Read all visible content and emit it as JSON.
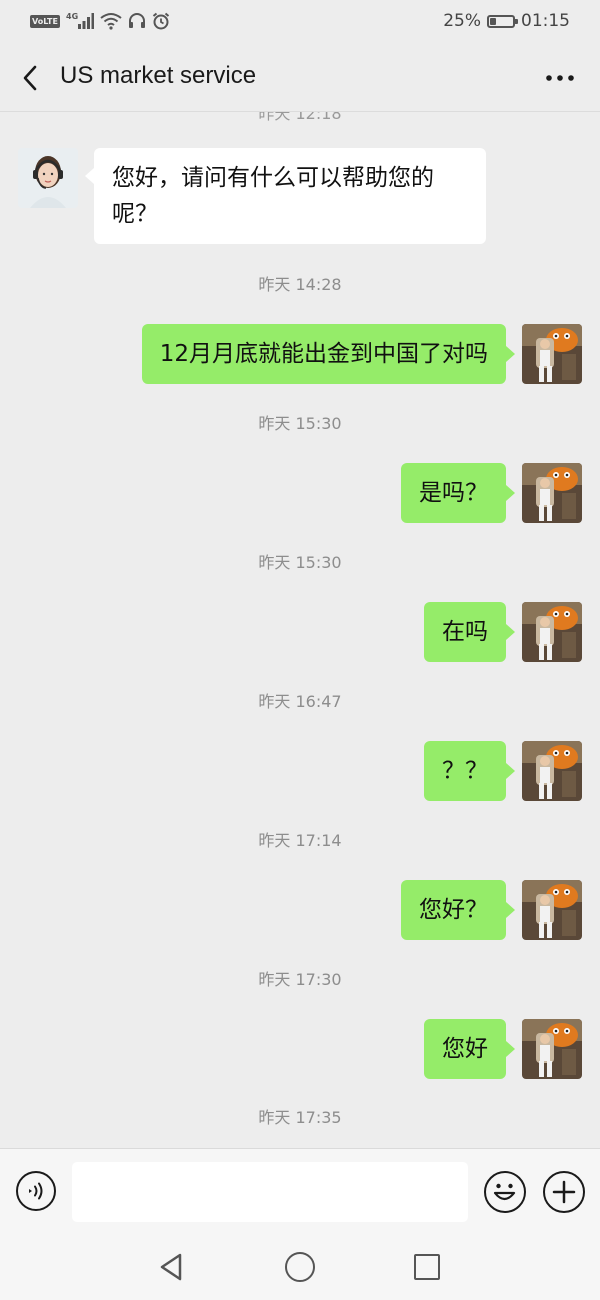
{
  "status_bar": {
    "network_badge": "VoLTE",
    "network_type": "4G",
    "icons": [
      "volte-icon",
      "signal-icon",
      "wifi-icon",
      "headphones-icon",
      "alarm-icon"
    ],
    "battery_percent": "25%",
    "battery_level": 0.25,
    "time": "01:15"
  },
  "header": {
    "title": "US market service",
    "back_icon": "chevron-left-icon",
    "more_icon": "more-dots-icon"
  },
  "chat": {
    "top_partial_timestamp": "昨天 12:18",
    "messages": [
      {
        "timestamp": "",
        "side": "in",
        "text": "您好，请问有什么可以帮助您的呢？"
      },
      {
        "timestamp": "昨天 14:28",
        "side": "out",
        "text": "12月月底就能出金到中国了对吗"
      },
      {
        "timestamp": "昨天 15:30",
        "side": "out",
        "text": "是吗？"
      },
      {
        "timestamp": "昨天 15:30",
        "side": "out",
        "text": "在吗"
      },
      {
        "timestamp": "昨天 16:47",
        "side": "out",
        "text": "？？"
      },
      {
        "timestamp": "昨天 17:14",
        "side": "out",
        "text": "您好？"
      },
      {
        "timestamp": "昨天 17:30",
        "side": "out",
        "text": "您好"
      }
    ],
    "last_timestamp": "昨天 17:35"
  },
  "input_bar": {
    "voice_icon": "voice-icon",
    "text_value": "",
    "emoji_icon": "emoji-icon",
    "plus_icon": "plus-icon"
  },
  "nav_bar": {
    "icons": [
      "nav-back-icon",
      "nav-home-icon",
      "nav-recent-icon"
    ]
  },
  "colors": {
    "background": "#ededed",
    "incoming_bubble": "#ffffff",
    "outgoing_bubble": "#95ec69",
    "timestamp_text": "#8d8d8d"
  }
}
